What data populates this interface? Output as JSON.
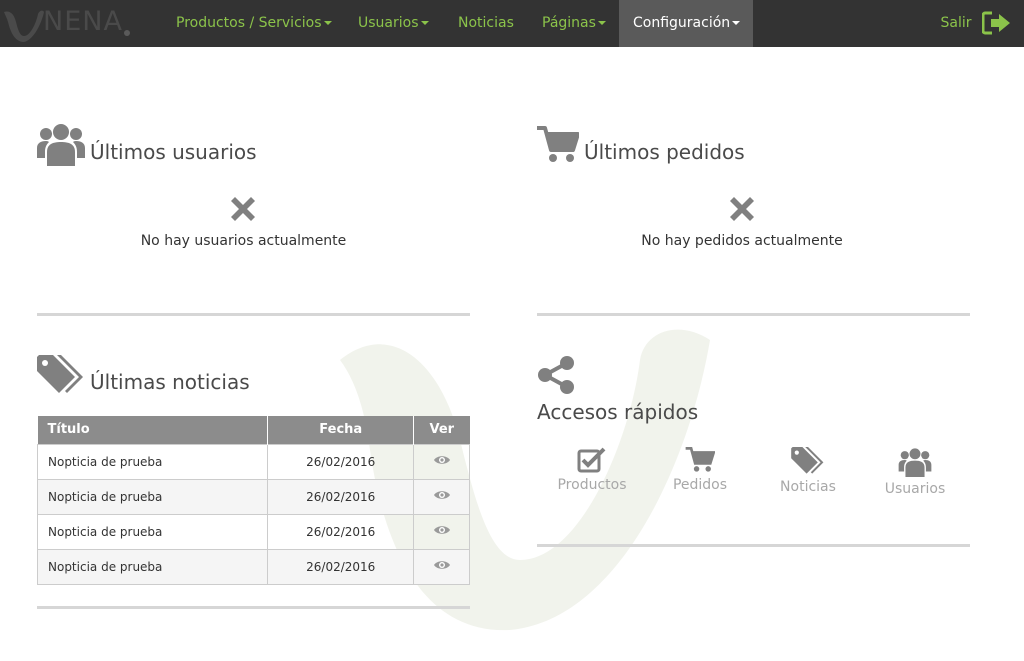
{
  "brand": {
    "name": "NENA"
  },
  "nav": {
    "items": [
      {
        "label": "Productos / Servicios",
        "dropdown": true
      },
      {
        "label": "Usuarios",
        "dropdown": true
      },
      {
        "label": "Noticias",
        "dropdown": false
      },
      {
        "label": "Páginas",
        "dropdown": true
      },
      {
        "label": "Configuración",
        "dropdown": true,
        "active": true
      }
    ],
    "logout_label": "Salir"
  },
  "users_panel": {
    "title": "Últimos usuarios",
    "empty_text": "No hay usuarios actualmente"
  },
  "orders_panel": {
    "title": "Últimos pedidos",
    "empty_text": "No hay pedidos actualmente"
  },
  "news_panel": {
    "title": "Últimas noticias",
    "columns": [
      "Título",
      "Fecha",
      "Ver"
    ],
    "rows": [
      {
        "title": "Nopticia de prueba",
        "date": "26/02/2016"
      },
      {
        "title": "Nopticia de prueba",
        "date": "26/02/2016"
      },
      {
        "title": "Nopticia de prueba",
        "date": "26/02/2016"
      },
      {
        "title": "Nopticia de prueba",
        "date": "26/02/2016"
      }
    ]
  },
  "quick_access": {
    "title": "Accesos rápidos",
    "items": [
      {
        "label": "Productos",
        "icon": "check-square-icon"
      },
      {
        "label": "Pedidos",
        "icon": "cart-icon"
      },
      {
        "label": "Noticias",
        "icon": "tags-icon"
      },
      {
        "label": "Usuarios",
        "icon": "users-icon"
      }
    ]
  },
  "colors": {
    "nav_bg": "#333333",
    "accent": "#8bc34a",
    "active_bg": "#5a5a5a",
    "icon_gray": "#808080",
    "table_header": "#8c8c8c"
  }
}
